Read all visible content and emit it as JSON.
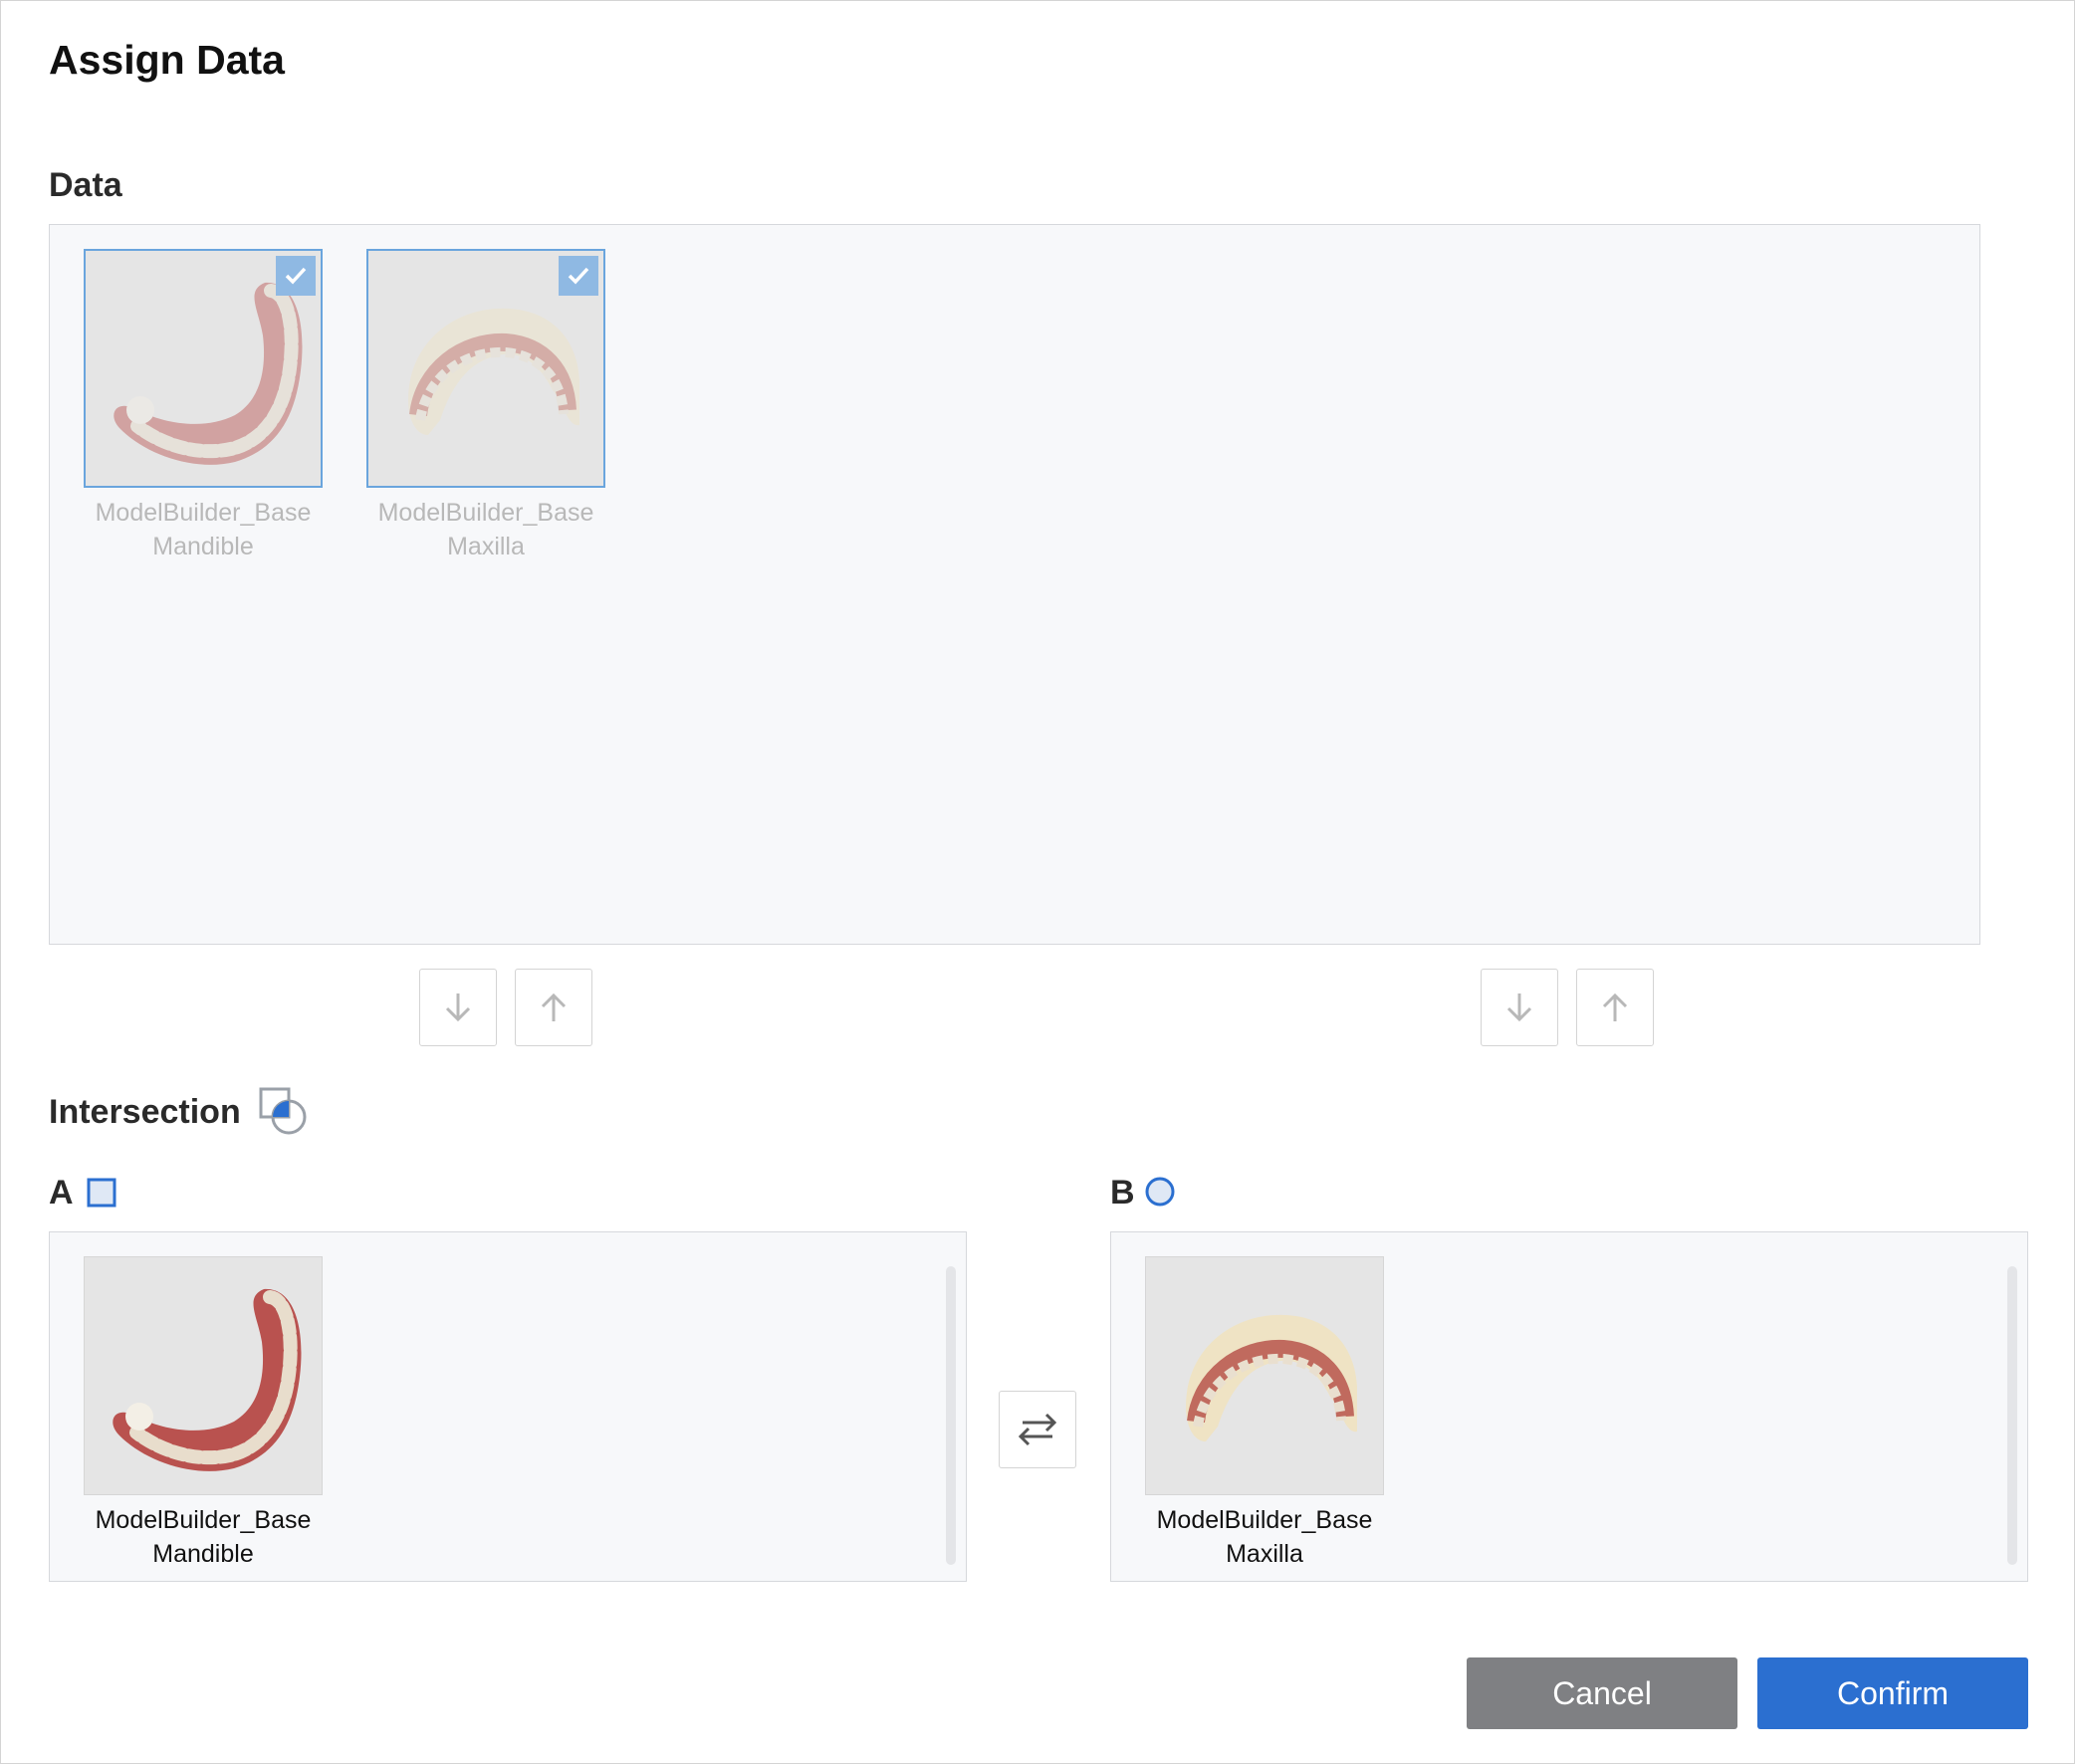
{
  "dialog": {
    "title": "Assign Data"
  },
  "data_section": {
    "label": "Data",
    "items": [
      {
        "name_line1": "ModelBuilder_Base",
        "name_line2": "Mandible",
        "selected": true,
        "model": "mandible-model"
      },
      {
        "name_line1": "ModelBuilder_Base",
        "name_line2": "Maxilla",
        "selected": true,
        "model": "maxilla-model"
      }
    ]
  },
  "move_buttons": {
    "left_down_icon": "arrow-down-icon",
    "left_up_icon": "arrow-up-icon",
    "right_down_icon": "arrow-down-icon",
    "right_up_icon": "arrow-up-icon"
  },
  "intersection": {
    "label": "Intersection",
    "icon": "intersection-icon"
  },
  "group_a": {
    "label": "A",
    "icon": "square-icon",
    "items": [
      {
        "name_line1": "ModelBuilder_Base",
        "name_line2": "Mandible",
        "model": "mandible-model"
      }
    ]
  },
  "group_b": {
    "label": "B",
    "icon": "circle-icon",
    "items": [
      {
        "name_line1": "ModelBuilder_Base",
        "name_line2": "Maxilla",
        "model": "maxilla-model"
      }
    ]
  },
  "swap_button": {
    "icon": "swap-arrows-icon"
  },
  "footer": {
    "cancel_label": "Cancel",
    "confirm_label": "Confirm"
  },
  "colors": {
    "accent": "#2b6fd0",
    "selection_border": "#6aa5dd",
    "checkbox": "#8fb9e3",
    "cancel": "#7f8083"
  }
}
